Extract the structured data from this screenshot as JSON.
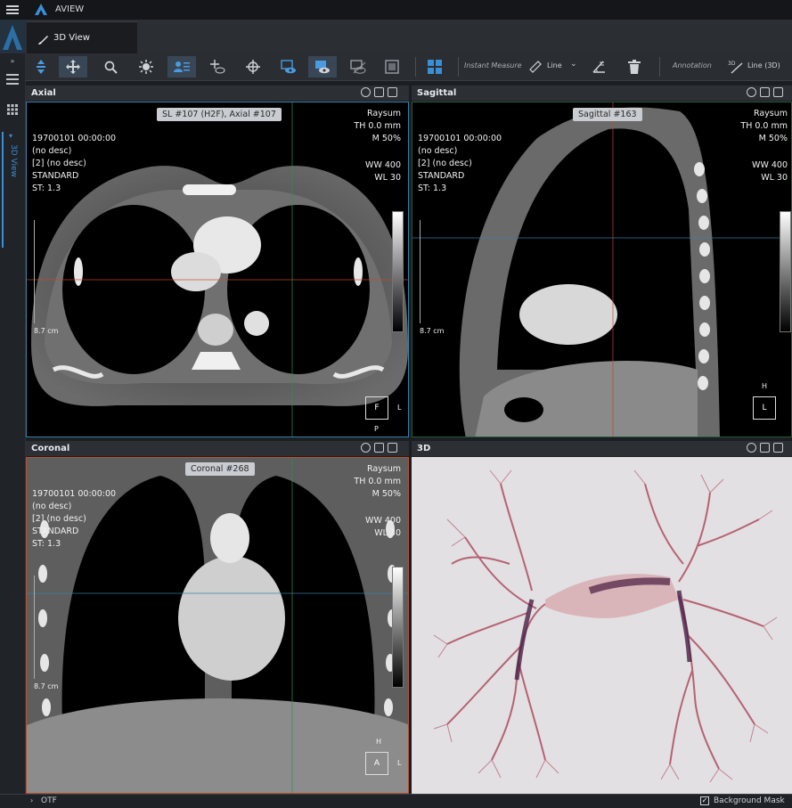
{
  "app": {
    "title": "AVIEW"
  },
  "tab": {
    "label": "3D View"
  },
  "rail": {
    "vertical_label": "3D View"
  },
  "toolbar": {
    "instant_measure": "Instant Measure",
    "line": "Line",
    "annotation": "Annotation",
    "line_3d": "Line (3D)"
  },
  "viewports": {
    "axial": {
      "title": "Axial",
      "chip": "SL #107 (H2F), Axial #107",
      "info": [
        "19700101 00:00:00",
        "(no desc)",
        "[2] (no desc)",
        "STANDARD",
        "ST: 1.3"
      ],
      "raysum": "Raysum",
      "th": "TH 0.0 mm",
      "m": "M 50%",
      "ww": "WW   400",
      "wl": "WL    30",
      "scale": "8.7 cm",
      "orient": {
        "center": "F",
        "right": "L",
        "bottom": "P"
      }
    },
    "sagittal": {
      "title": "Sagittal",
      "chip": "Sagittal #163",
      "info": [
        "19700101 00:00:00",
        "(no desc)",
        "[2] (no desc)",
        "STANDARD",
        "ST: 1.3"
      ],
      "raysum": "Raysum",
      "th": "TH 0.0 mm",
      "m": "M 50%",
      "ww": "WW   400",
      "wl": "WL    30",
      "scale": "8.7 cm",
      "orient": {
        "center": "L",
        "top": "H"
      }
    },
    "coronal": {
      "title": "Coronal",
      "chip": "Coronal #268",
      "info": [
        "19700101 00:00:00",
        "(no desc)",
        "[2] (no desc)",
        "STANDARD",
        "ST: 1.3"
      ],
      "raysum": "Raysum",
      "th": "TH 0.0 mm",
      "m": "M 50%",
      "ww": "WW   400",
      "wl": "WL    30",
      "scale": "8.7 cm",
      "orient": {
        "center": "A",
        "right": "L",
        "top": "H"
      }
    },
    "threed": {
      "title": "3D"
    }
  },
  "bottom": {
    "otf": "OTF",
    "background_mask": "Background Mask"
  },
  "colors": {
    "accent": "#3a8fd6",
    "axial_border": "#3b7fa8",
    "coronal_border": "#b5522f",
    "crosshair_h": "#c0482f",
    "crosshair_v": "#2f8f4f"
  }
}
